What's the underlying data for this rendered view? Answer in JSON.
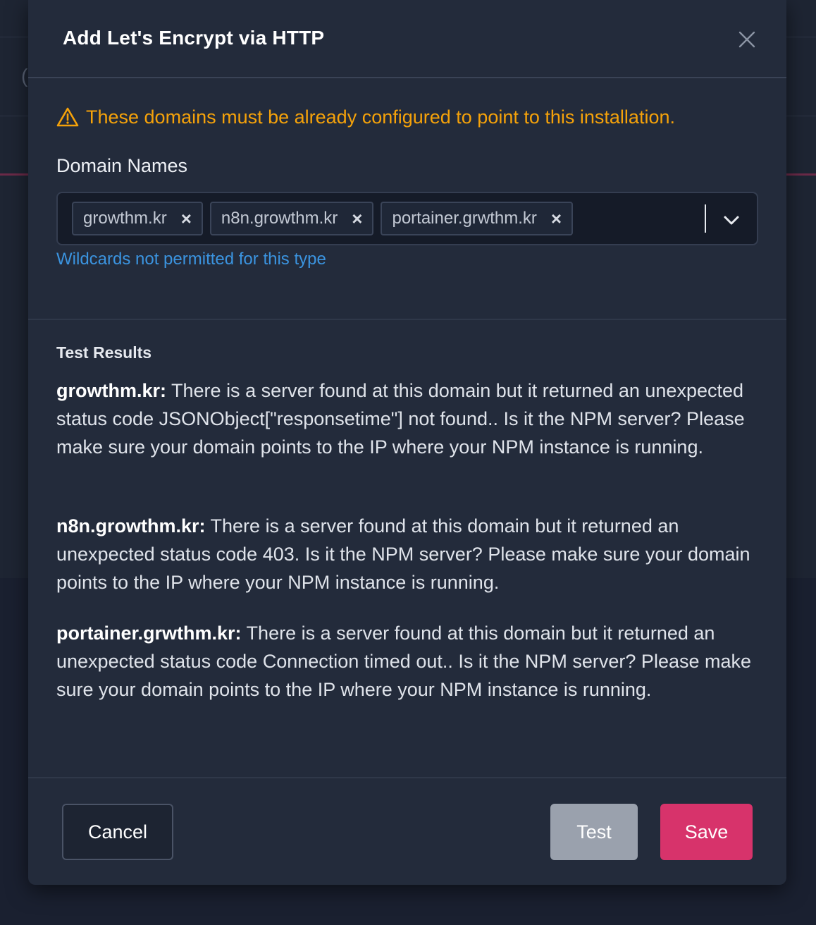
{
  "modal": {
    "title": "Add Let's Encrypt via HTTP",
    "warning": "These domains must be already configured to point to this installation.",
    "domain_label": "Domain Names",
    "domains": [
      "growthm.kr",
      "n8n.growthm.kr",
      "portainer.grwthm.kr"
    ],
    "tag_remove_glyph": "×",
    "hint": "Wildcards not permitted for this type",
    "results_heading": "Test Results",
    "results": [
      {
        "domain": "growthm.kr:",
        "text": " There is a server found at this domain but it returned an unexpected status code JSONObject[\"responsetime\"] not found.. Is it the NPM server? Please make sure your domain points to the IP where your NPM instance is running."
      },
      {
        "domain": "n8n.growthm.kr:",
        "text": " There is a server found at this domain but it returned an unexpected status code 403. Is it the NPM server? Please make sure your domain points to the IP where your NPM instance is running."
      },
      {
        "domain": "portainer.grwthm.kr:",
        "text": " There is a server found at this domain but it returned an unexpected status code Connection timed out.. Is it the NPM server? Please make sure your domain points to the IP where your NPM instance is running."
      }
    ],
    "buttons": {
      "cancel": "Cancel",
      "test": "Test",
      "save": "Save"
    }
  },
  "icons": {
    "close": "close-icon",
    "warning": "warning-triangle-icon",
    "chevron": "chevron-down-icon"
  },
  "colors": {
    "warning": "#f5a20a",
    "hint": "#3b94e0",
    "save": "#d7336b",
    "test": "#9aa1ad"
  }
}
